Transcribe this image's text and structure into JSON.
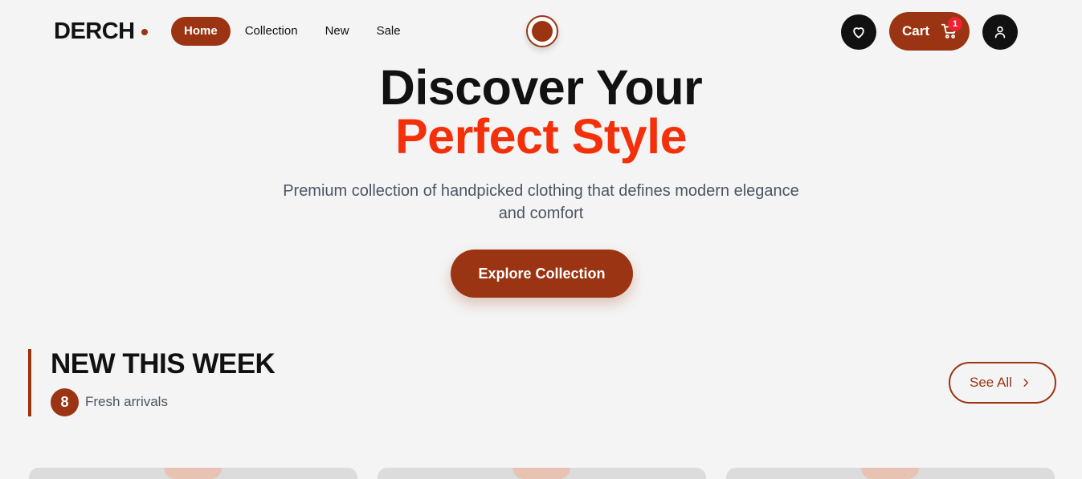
{
  "header": {
    "brand": "DERCH",
    "nav": [
      "Home",
      "Collection",
      "New",
      "Sale"
    ],
    "active_nav": "Home",
    "cart_label": "Cart",
    "cart_count": "1",
    "icons": [
      "heart-icon",
      "cart-icon",
      "user-icon"
    ]
  },
  "hero": {
    "title_line1": "Discover Your",
    "title_line2": "Perfect Style",
    "subtitle": "Premium collection of handpicked clothing that defines modern elegance and comfort",
    "cta": "Explore Collection"
  },
  "section": {
    "title": "NEW THIS WEEK",
    "count": "8",
    "count_label": "Fresh arrivals",
    "see_all": "See All"
  },
  "colors": {
    "accent": "#9b3412",
    "highlight": "#f4300a",
    "badge": "#ef2233",
    "background": "#f4f4f4"
  }
}
